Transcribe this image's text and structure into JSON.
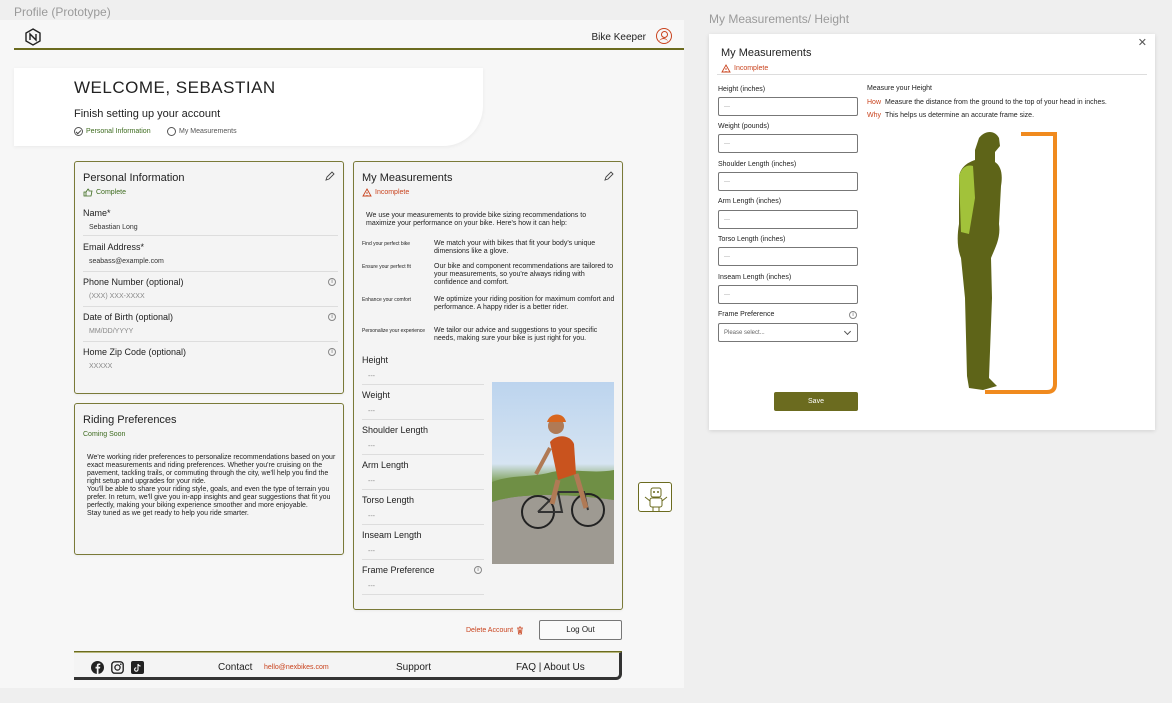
{
  "labels": {
    "frame1": "Profile (Prototype)",
    "frame2": "My Measurements/ Height"
  },
  "header": {
    "app_name": "Bike Keeper"
  },
  "welcome": {
    "title": "WELCOME, SEBASTIAN",
    "subtitle": "Finish setting up your account",
    "steps": [
      "Personal Information",
      "My Measurements"
    ]
  },
  "personal": {
    "title": "Personal Information",
    "status": "Complete",
    "fields": [
      {
        "label": "Name*",
        "value": "Sebastian Long"
      },
      {
        "label": "Email Address*",
        "value": "seabass@example.com"
      },
      {
        "label": "Phone Number (optional)",
        "value": "(XXX) XXX-XXXX"
      },
      {
        "label": "Date of Birth (optional)",
        "value": "MM/DD/YYYY"
      },
      {
        "label": "Home Zip Code (optional)",
        "value": "XXXXX"
      }
    ]
  },
  "riding": {
    "title": "Riding Preferences",
    "status": "Coming Soon",
    "p1": "We're working rider preferences to personalize recommendations based on your exact measurements and riding preferences. Whether you're cruising on the pavement, tackling trails, or commuting through the city, we'll help you find the right setup and upgrades for your ride.",
    "p2": "You'll be able to share your riding style, goals, and even the type of terrain you prefer. In return, we'll give you in-app insights and gear suggestions that fit you perfectly, making your biking experience smoother and more enjoyable.",
    "p3": "Stay tuned as we get ready to help you ride smarter."
  },
  "measurements": {
    "title": "My Measurements",
    "status": "Incomplete",
    "intro": "We use your measurements to provide bike sizing recommendations to maximize your performance on your bike. Here's how it can help:",
    "benefits": [
      {
        "key": "Find your perfect bike",
        "desc": "We match your with bikes that fit your body's unique dimensions like a glove."
      },
      {
        "key": "Ensure your perfect fit",
        "desc": "Our bike and component recommendations are tailored to your measurements, so you're always riding with confidence and comfort."
      },
      {
        "key": "Enhance your comfort",
        "desc": "We optimize your riding position for maximum comfort and performance. A happy rider is a better rider."
      },
      {
        "key": "Personalize your experience",
        "desc": "We tailor our advice and suggestions to your specific needs, making sure your bike is just right for you."
      }
    ],
    "fields": [
      {
        "label": "Height",
        "value": "---"
      },
      {
        "label": "Weight",
        "value": "---"
      },
      {
        "label": "Shoulder Length",
        "value": "---"
      },
      {
        "label": "Arm Length",
        "value": "---"
      },
      {
        "label": "Torso Length",
        "value": "---"
      },
      {
        "label": "Inseam Length",
        "value": "---"
      },
      {
        "label": "Frame Preference",
        "value": "---"
      }
    ]
  },
  "actions": {
    "delete": "Delete Account",
    "logout": "Log Out"
  },
  "footer": {
    "contact": "Contact",
    "email": "hello@nexbikes.com",
    "support": "Support",
    "faq": "FAQ | About Us"
  },
  "modal": {
    "title": "My Measurements",
    "status": "Incomplete",
    "fields": [
      {
        "label": "Height (inches)",
        "placeholder": "---"
      },
      {
        "label": "Weight (pounds)",
        "placeholder": "---"
      },
      {
        "label": "Shoulder Length (inches)",
        "placeholder": "---"
      },
      {
        "label": "Arm Length (inches)",
        "placeholder": "---"
      },
      {
        "label": "Torso Length (inches)",
        "placeholder": "---"
      },
      {
        "label": "Inseam Length (inches)",
        "placeholder": "---"
      }
    ],
    "frame_label": "Frame Preference",
    "frame_placeholder": "Please select...",
    "save": "Save",
    "guide_title": "Measure your Height",
    "how_label": "How",
    "how": "Measure the distance from the ground to the top of your head in inches.",
    "why_label": "Why",
    "why": "This helps us determine an accurate frame size."
  },
  "colors": {
    "olive": "#6b6b1f",
    "accent": "#c9431e",
    "orange": "#f08a1e",
    "figure": "#5e6418",
    "highlight": "#a2c23a"
  }
}
